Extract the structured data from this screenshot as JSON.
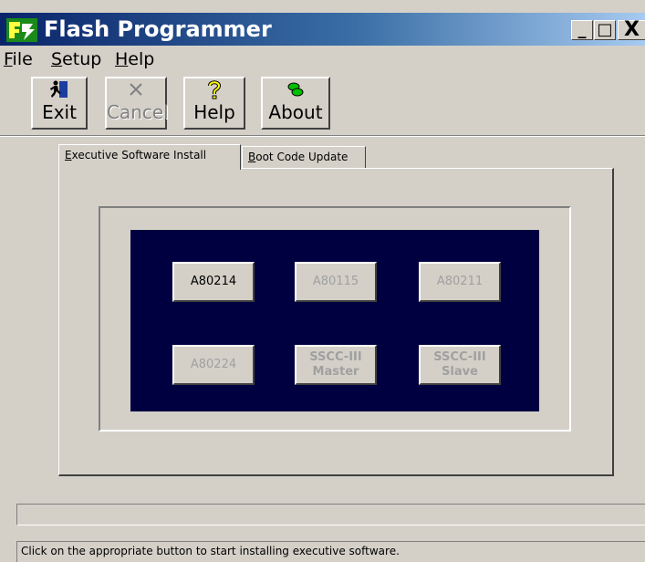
{
  "window": {
    "title": "Flash Programmer",
    "icon": "flash-programmer-icon",
    "controls": {
      "minimize": "_",
      "maximize": "□",
      "close": "X"
    }
  },
  "menu": [
    {
      "label": "File",
      "mnemonic": "F",
      "rest": "ile"
    },
    {
      "label": "Setup",
      "mnemonic": "S",
      "rest": "etup"
    },
    {
      "label": "Help",
      "mnemonic": "H",
      "rest": "elp"
    }
  ],
  "toolbar": {
    "exit": {
      "label": "Exit",
      "icon": "exit-running-man-icon",
      "enabled": true
    },
    "cancel": {
      "label": "Cancel",
      "icon": "cancel-x-icon",
      "enabled": false
    },
    "help": {
      "label": "Help",
      "icon": "question-mark-icon",
      "enabled": true
    },
    "about": {
      "label": "About",
      "icon": "about-icon",
      "enabled": true
    }
  },
  "tabs": [
    {
      "label": "Executive Software Install",
      "mnemonic": "E",
      "rest": "xecutive Software Install",
      "selected": true
    },
    {
      "label": "Boot Code Update",
      "mnemonic": "B",
      "rest": "oot Code Update",
      "selected": false
    }
  ],
  "software_buttons": [
    {
      "label": "A80214",
      "enabled": true
    },
    {
      "label": "A80115",
      "enabled": false
    },
    {
      "label": "A80211",
      "enabled": false
    },
    {
      "label": "A80224",
      "enabled": false
    },
    {
      "label_line1": "SSCC-III",
      "label_line2": "Master",
      "enabled": false
    },
    {
      "label_line1": "SSCC-III",
      "label_line2": "Slave",
      "enabled": false
    }
  ],
  "status": {
    "message": "Click on the appropriate button to start installing executive software."
  },
  "colors": {
    "face": "#d4d0c8",
    "panel_dark": "#000040",
    "title_gradient_start": "#0a246a",
    "title_gradient_end": "#a6caf0"
  }
}
